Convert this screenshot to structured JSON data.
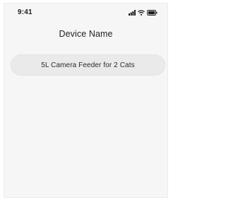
{
  "status_bar": {
    "time": "9:41",
    "icons": [
      "signal-icon",
      "wifi-icon",
      "battery-icon"
    ]
  },
  "header": {
    "title": "Device Name"
  },
  "device_name_field": {
    "value": "5L Camera Feeder for 2 Cats"
  },
  "colors": {
    "screen_background": "#f6f6f6",
    "field_background": "#eaeaea",
    "text": "#222222"
  }
}
